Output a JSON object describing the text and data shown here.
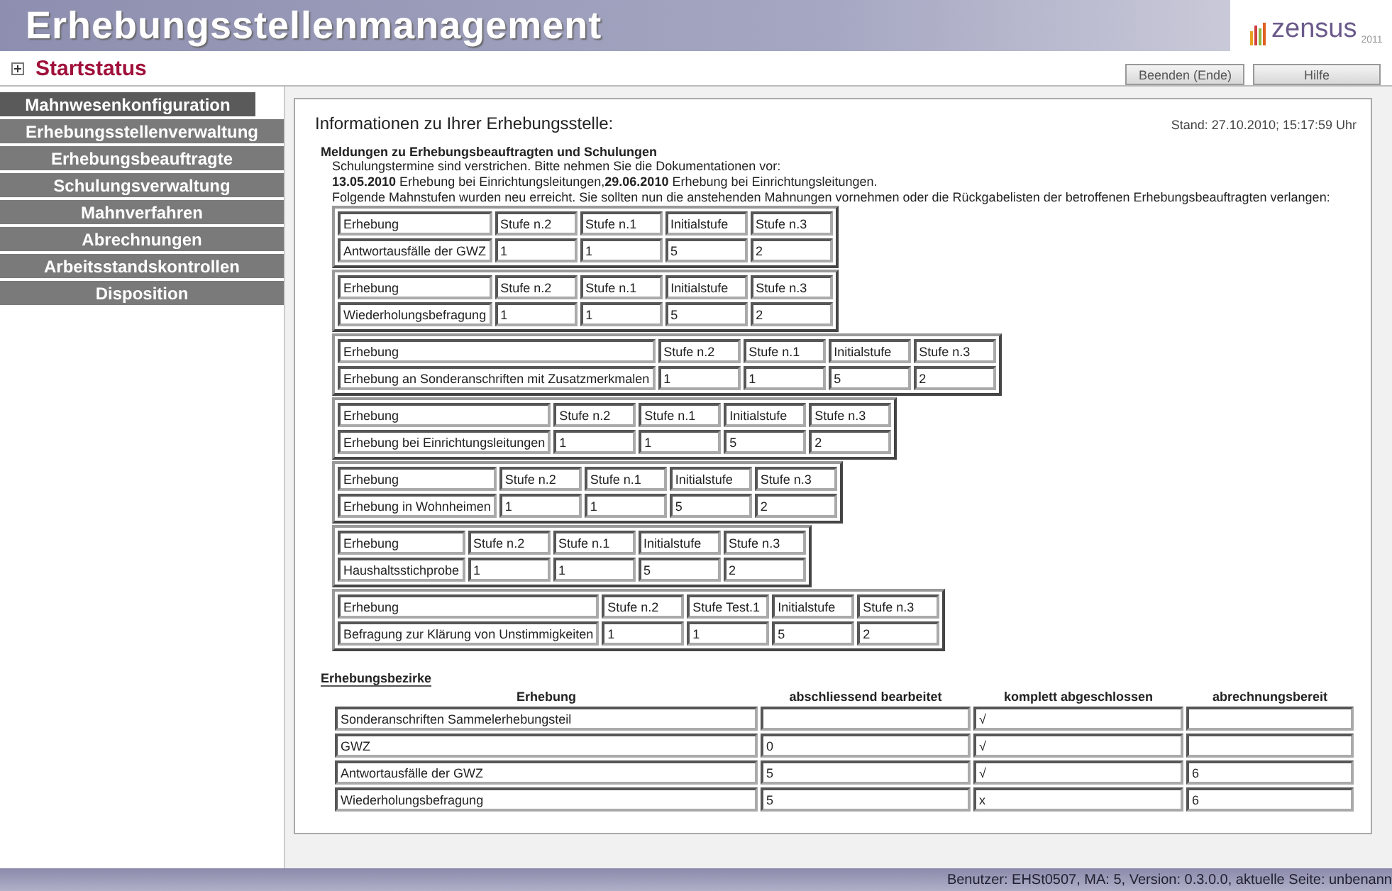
{
  "header": {
    "title": "Erhebungsstellenmanagement",
    "logo_text": "zensus",
    "logo_year": "2011"
  },
  "startstatus": {
    "label": "Startstatus",
    "expanded": false
  },
  "top_buttons": [
    "Beenden (Ende)",
    "Hilfe"
  ],
  "sidebar": {
    "items": [
      {
        "label": "Mahnwesenkonfiguration",
        "selected": true
      },
      {
        "label": "Erhebungsstellenverwaltung",
        "selected": false
      },
      {
        "label": "Erhebungsbeauftragte",
        "selected": false
      },
      {
        "label": "Schulungsverwaltung",
        "selected": false
      },
      {
        "label": "Mahnverfahren",
        "selected": false
      },
      {
        "label": "Abrechnungen",
        "selected": false
      },
      {
        "label": "Arbeitsstandskontrollen",
        "selected": false
      },
      {
        "label": "Disposition",
        "selected": false
      }
    ]
  },
  "content": {
    "title": "Informationen zu Ihrer Erhebungsstelle:",
    "timestamp": "Stand: 27.10.2010; 15:17:59 Uhr",
    "messages": {
      "heading": "Meldungen zu Erhebungsbeauftragten und Schulungen",
      "lines": [
        "Schulungstermine sind verstrichen. Bitte nehmen Sie die Dokumentationen vor:",
        "**13.05.2010** Erhebung bei Einrichtungsleitungen,**29.06.2010** Erhebung bei Einrichtungsleitungen.",
        "Folgende Mahnstufen wurden neu erreicht. Sie sollten nun die anstehenden Mahnungen vornehmen oder die Rückgabelisten der betroffenen Erhebungsbeauftragten verlangen:"
      ],
      "tables": [
        {
          "columns": [
            "Erhebung",
            "Stufe n.2",
            "Stufe n.1",
            "Initialstufe",
            "Stufe n.3"
          ],
          "row": [
            "Antwortausfälle der GWZ",
            "1",
            "1",
            "5",
            "2"
          ]
        },
        {
          "columns": [
            "Erhebung",
            "Stufe n.2",
            "Stufe n.1",
            "Initialstufe",
            "Stufe n.3"
          ],
          "row": [
            "Wiederholungsbefragung",
            "1",
            "1",
            "5",
            "2"
          ]
        },
        {
          "columns": [
            "Erhebung",
            "Stufe n.2",
            "Stufe n.1",
            "Initialstufe",
            "Stufe n.3"
          ],
          "row": [
            "Erhebung an Sonderanschriften mit Zusatzmerkmalen",
            "1",
            "1",
            "5",
            "2"
          ]
        },
        {
          "columns": [
            "Erhebung",
            "Stufe n.2",
            "Stufe n.1",
            "Initialstufe",
            "Stufe n.3"
          ],
          "row": [
            "Erhebung bei Einrichtungsleitungen",
            "1",
            "1",
            "5",
            "2"
          ]
        },
        {
          "columns": [
            "Erhebung",
            "Stufe n.2",
            "Stufe n.1",
            "Initialstufe",
            "Stufe n.3"
          ],
          "row": [
            "Erhebung in Wohnheimen",
            "1",
            "1",
            "5",
            "2"
          ]
        },
        {
          "columns": [
            "Erhebung",
            "Stufe n.2",
            "Stufe n.1",
            "Initialstufe",
            "Stufe n.3"
          ],
          "row": [
            "Haushaltsstichprobe",
            "1",
            "1",
            "5",
            "2"
          ]
        },
        {
          "columns": [
            "Erhebung",
            "Stufe n.2",
            "Stufe Test.1",
            "Initialstufe",
            "Stufe n.3"
          ],
          "row": [
            "Befragung zur Klärung von Unstimmigkeiten",
            "1",
            "1",
            "5",
            "2"
          ]
        }
      ]
    },
    "districts": {
      "heading": "Erhebungsbezirke",
      "columns": [
        "Erhebung",
        "abschliessend bearbeitet",
        "komplett abgeschlossen",
        "abrechnungsbereit"
      ],
      "rows": [
        {
          "erhebung": "Sonderanschriften Sammelerhebungsteil",
          "komplett": "√"
        },
        {
          "erhebung": "GWZ",
          "bearbeitet": "0",
          "komplett": "√"
        },
        {
          "erhebung": "Antwortausfälle der GWZ",
          "bearbeitet": "5",
          "komplett": "√",
          "abrechnung": "6"
        },
        {
          "erhebung": "Wiederholungsbefragung",
          "bearbeitet": "5",
          "komplett": "x",
          "abrechnung": "6"
        }
      ]
    }
  },
  "status_bar": "Benutzer: EHSt0507, MA: 5, Version: 0.3.0.0, aktuelle Seite: unbenann"
}
